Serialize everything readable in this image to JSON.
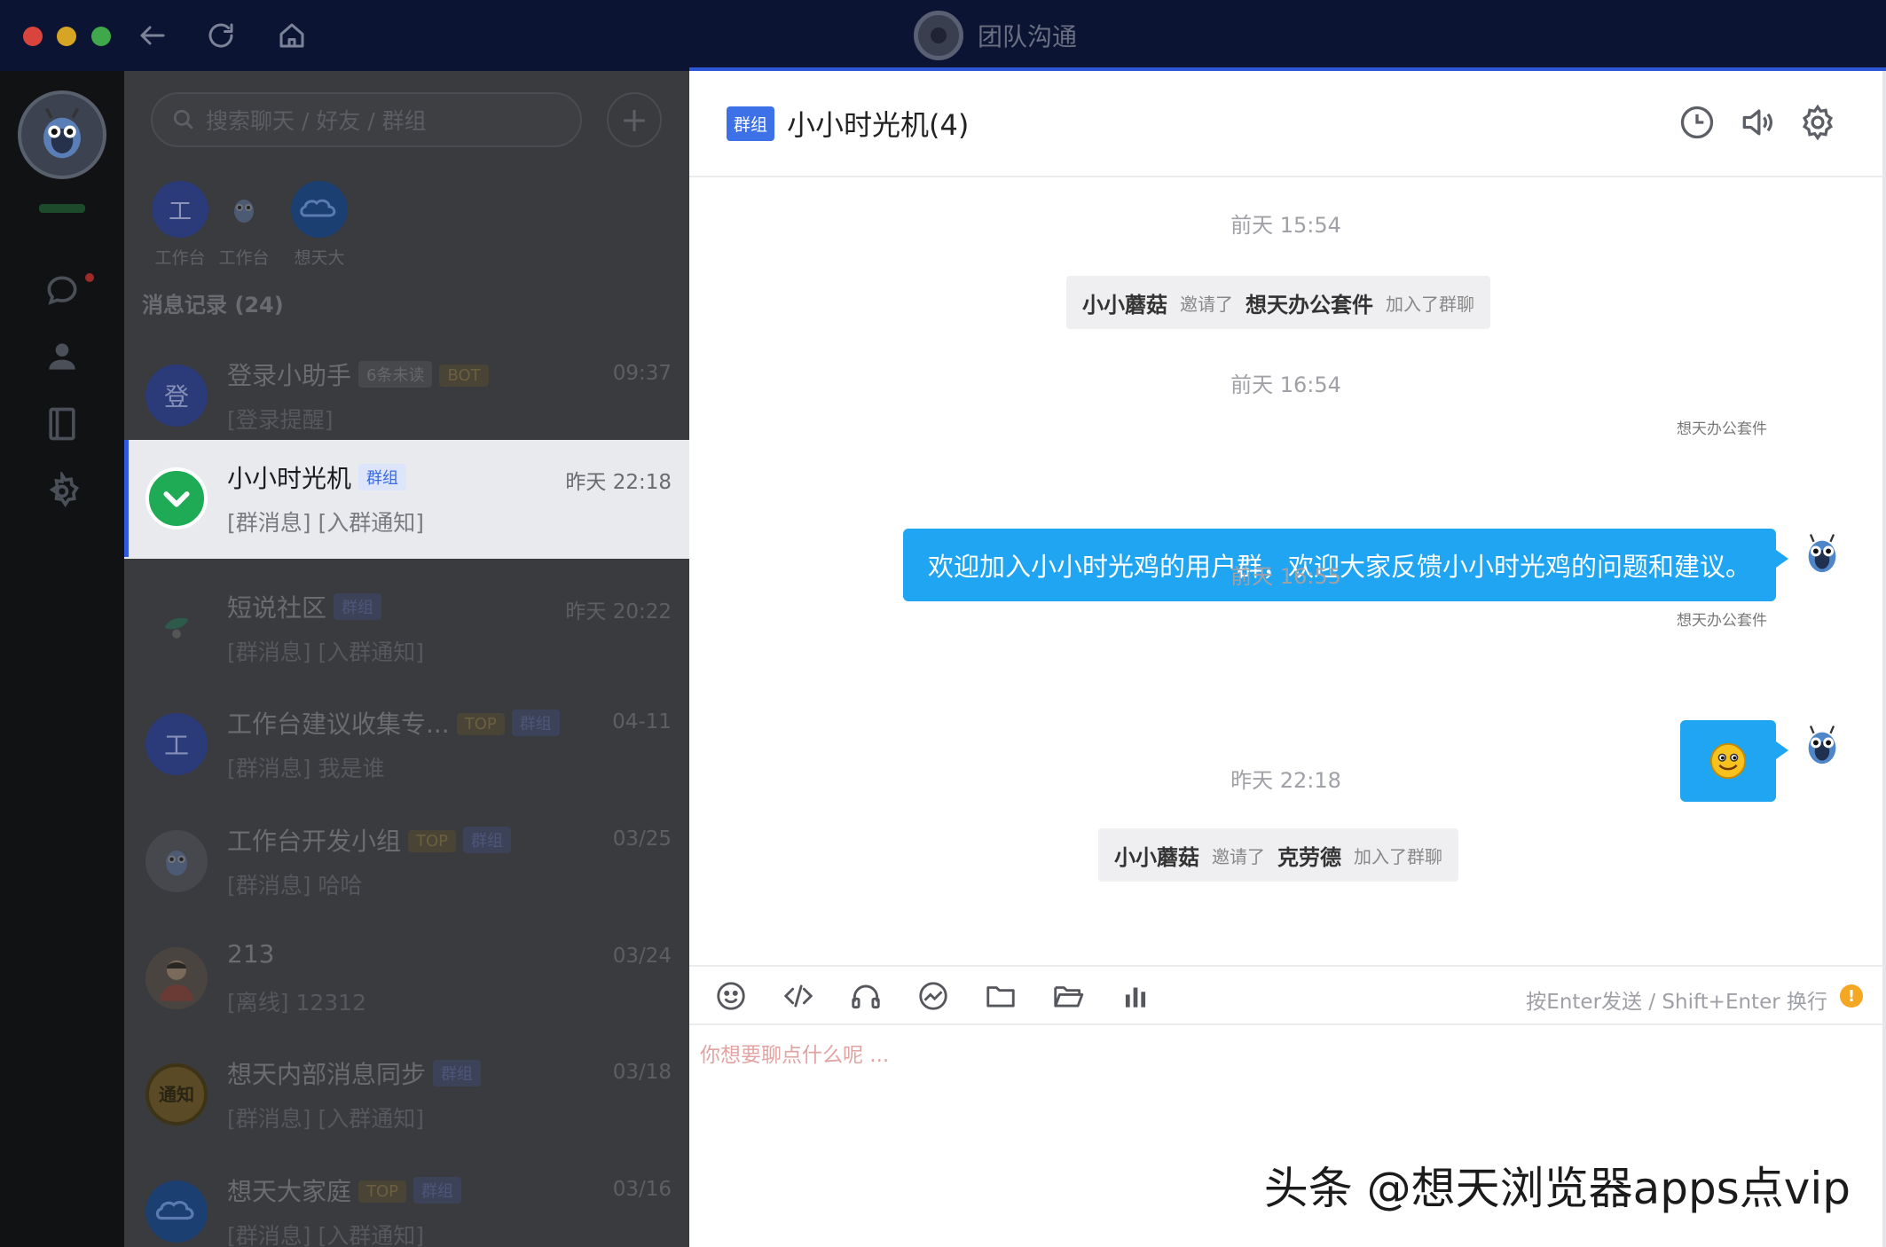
{
  "window": {
    "title": "团队沟通"
  },
  "sidebar": {
    "search_placeholder": "搜索聊天 / 好友 / 群组",
    "add_label": "+",
    "quick_access": [
      {
        "label": "工作台",
        "icon_text": "工"
      },
      {
        "label": "工作台",
        "icon_text": ""
      },
      {
        "label": "想天大",
        "icon_text": ""
      }
    ],
    "section_title": "消息记录 (24)",
    "conversations": [
      {
        "name": "登录小助手",
        "tags": [
          "6条未读",
          "BOT"
        ],
        "time": "09:37",
        "preview": "[登录提醒]",
        "avatar_text": "登",
        "avatar_color": "#2b3a78"
      },
      {
        "name": "小小时光机",
        "tags": [
          "群组"
        ],
        "time": "昨天 22:18",
        "preview": "[群消息] [入群通知]",
        "avatar_text": "",
        "avatar_color": "#1faa55"
      },
      {
        "name": "短说社区",
        "tags": [
          "群组"
        ],
        "time": "昨天 20:22",
        "preview": "[群消息] [入群通知]",
        "avatar_text": "",
        "avatar_color": "#3a3b3e"
      },
      {
        "name": "工作台建议收集专...",
        "tags": [
          "TOP",
          "群组"
        ],
        "time": "04-11",
        "preview": "[群消息] 我是谁",
        "avatar_text": "工",
        "avatar_color": "#2b3a78"
      },
      {
        "name": "工作台开发小组",
        "tags": [
          "TOP",
          "群组"
        ],
        "time": "03/25",
        "preview": "[群消息] 哈哈",
        "avatar_text": "",
        "avatar_color": "#46484d"
      },
      {
        "name": "213",
        "tags": [],
        "time": "03/24",
        "preview": "[离线] 12312",
        "avatar_text": "",
        "avatar_color": "#4a4440"
      },
      {
        "name": "想天内部消息同步",
        "tags": [
          "群组"
        ],
        "time": "03/18",
        "preview": "[群消息] [入群通知]",
        "avatar_text": "通知",
        "avatar_color": "#5a4a25"
      },
      {
        "name": "想天大家庭",
        "tags": [
          "TOP",
          "群组"
        ],
        "time": "03/16",
        "preview": "[群消息] [入群通知]",
        "avatar_text": "",
        "avatar_color": "#1b3f70"
      }
    ]
  },
  "chat": {
    "badge": "群组",
    "title": "小小时光机(4)",
    "timeline": [
      {
        "type": "time",
        "text": "前天 15:54"
      },
      {
        "type": "system",
        "actor": "小小蘑菇",
        "verb": "邀请了",
        "target": "想天办公套件",
        "suffix": "加入了群聊"
      },
      {
        "type": "time",
        "text": "前天 16:54"
      },
      {
        "type": "message",
        "sender": "想天办公套件",
        "text": "欢迎加入小小时光鸡的用户群，欢迎大家反馈小小时光鸡的问题和建议。"
      },
      {
        "type": "time",
        "text": "前天 16:55"
      },
      {
        "type": "message",
        "sender": "想天办公套件",
        "emoji": "smile-emoji"
      },
      {
        "type": "time",
        "text": "昨天 22:18"
      },
      {
        "type": "system",
        "actor": "小小蘑菇",
        "verb": "邀请了",
        "target": "克劳德",
        "suffix": "加入了群聊"
      }
    ],
    "toolbar_hint": "按Enter发送 / Shift+Enter 换行",
    "input_placeholder": "你想要聊点什么呢 ..."
  },
  "watermark": "头条 @想天浏览器apps点vip",
  "colors": {
    "accent": "#3159e0",
    "bubble": "#1fa5f2",
    "titlebar": "#0b1533"
  }
}
